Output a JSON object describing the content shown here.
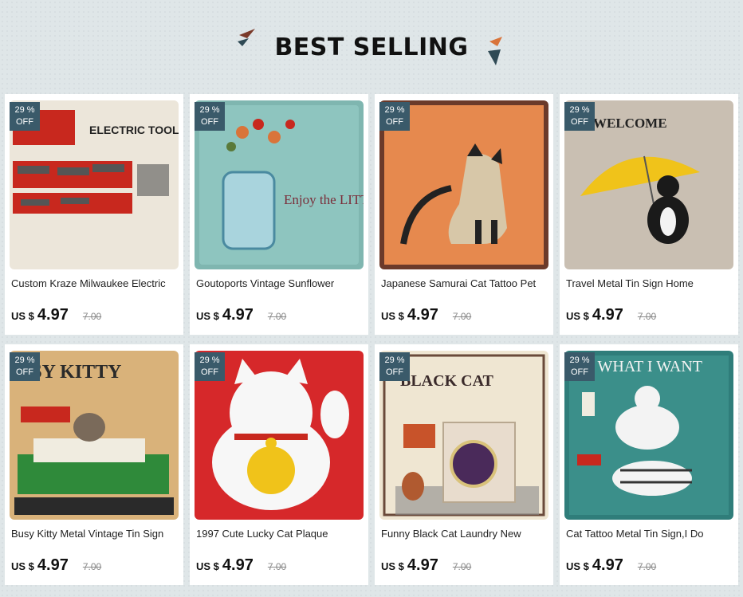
{
  "section": {
    "title": "BEST SELLING"
  },
  "products": [
    {
      "name": "Custom Kraze Milwaukee Electric",
      "discount_pct": "29 %",
      "discount_off": "OFF",
      "currency": "US $",
      "price": "4.97",
      "original_price": "7.00",
      "thumb_text": "ELECTRIC TOOLS"
    },
    {
      "name": "Goutoports Vintage Sunflower",
      "discount_pct": "29 %",
      "discount_off": "OFF",
      "currency": "US $",
      "price": "4.97",
      "original_price": "7.00",
      "thumb_text": "Enjoy the LITTLE Things"
    },
    {
      "name": "Japanese Samurai Cat Tattoo Pet",
      "discount_pct": "29 %",
      "discount_off": "OFF",
      "currency": "US $",
      "price": "4.97",
      "original_price": "7.00",
      "thumb_text": ""
    },
    {
      "name": "Travel Metal Tin Sign Home",
      "discount_pct": "29 %",
      "discount_off": "OFF",
      "currency": "US $",
      "price": "4.97",
      "original_price": "7.00",
      "thumb_text": "WELCOME"
    },
    {
      "name": "Busy Kitty Metal Vintage Tin Sign",
      "discount_pct": "29 %",
      "discount_off": "OFF",
      "currency": "US $",
      "price": "4.97",
      "original_price": "7.00",
      "thumb_text": "USY KITTY"
    },
    {
      "name": "1997 Cute Lucky Cat Plaque",
      "discount_pct": "29 %",
      "discount_off": "OFF",
      "currency": "US $",
      "price": "4.97",
      "original_price": "7.00",
      "thumb_text": ""
    },
    {
      "name": "Funny Black Cat Laundry New",
      "discount_pct": "29 %",
      "discount_off": "OFF",
      "currency": "US $",
      "price": "4.97",
      "original_price": "7.00",
      "thumb_text": "BLACK CAT"
    },
    {
      "name": "Cat Tattoo Metal Tin Sign,I Do",
      "discount_pct": "29 %",
      "discount_off": "OFF",
      "currency": "US $",
      "price": "4.97",
      "original_price": "7.00",
      "thumb_text": "DO WHAT I WANT"
    }
  ],
  "colors": {
    "badge": "#3a5a6a",
    "deco_orange": "#d9743a",
    "deco_dark": "#2f4a55"
  }
}
